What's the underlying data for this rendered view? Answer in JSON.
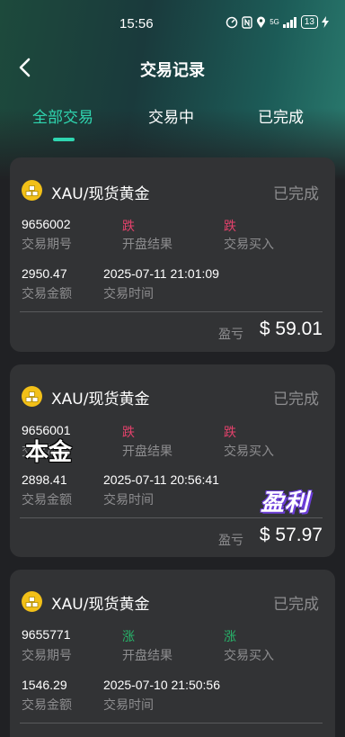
{
  "status_bar": {
    "time": "15:56",
    "network": "5G",
    "battery": "13"
  },
  "nav": {
    "title": "交易记录"
  },
  "tabs": [
    {
      "label": "全部交易",
      "active": true
    },
    {
      "label": "交易中",
      "active": false
    },
    {
      "label": "已完成",
      "active": false
    }
  ],
  "labels": {
    "period": "交易期号",
    "result": "开盘结果",
    "buy": "交易买入",
    "amount": "交易金额",
    "time": "交易时间",
    "pl": "盈亏"
  },
  "records": [
    {
      "title": "XAU/现货黄金",
      "status": "已完成",
      "period": "9656002",
      "result": "跌",
      "buy": "跌",
      "amount": "2950.47",
      "time": "2025-07-11 21:01:09",
      "pl": "$ 59.01"
    },
    {
      "title": "XAU/现货黄金",
      "status": "已完成",
      "period": "9656001",
      "result": "跌",
      "buy": "跌",
      "amount": "2898.41",
      "time": "2025-07-11 20:56:41",
      "pl": "$ 57.97"
    },
    {
      "title": "XAU/现货黄金",
      "status": "已完成",
      "period": "9655771",
      "result": "涨",
      "buy": "涨",
      "amount": "1546.29",
      "time": "2025-07-10 21:50:56",
      "pl": ""
    }
  ],
  "overlays": {
    "principal": "本金",
    "profit": "盈利"
  },
  "colors": {
    "accent": "#2fd6b0",
    "down": "#e5426c",
    "up": "#27b56a",
    "gold": "#f2c018"
  }
}
